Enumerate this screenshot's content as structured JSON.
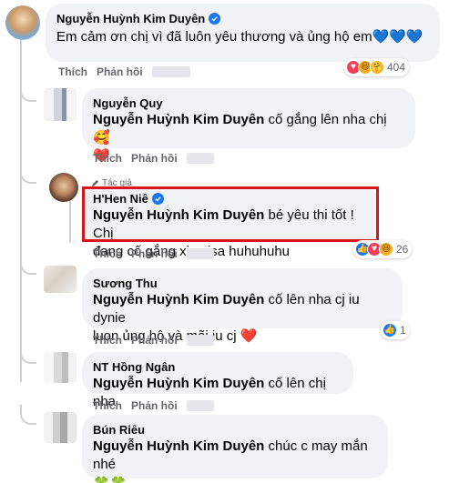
{
  "comments": [
    {
      "author": "Nguyễn Huỳnh Kim Duyên",
      "verified": true,
      "text": "Em cảm ơn chị vì đã luôn yêu thương và ủng hộ em",
      "emoji": "💙💙💙",
      "actions": {
        "like": "Thích",
        "reply": "Phản hồi"
      },
      "reactions": {
        "icons": [
          "heart-icon",
          "haha-icon",
          "care-icon"
        ],
        "count": "404"
      }
    }
  ],
  "replies": [
    {
      "author": "Nguyễn Quy",
      "mention": "Nguyễn Huỳnh Kim Duyên",
      "text": "cố gắng lên nha chị 🥰",
      "text2": "❤️",
      "actions": {
        "like": "Thích",
        "reply": "Phản hồi"
      }
    },
    {
      "badge": "Tác giả",
      "author": "H'Hen Niê",
      "verified": true,
      "mention": "Nguyễn Huỳnh Kim Duyên",
      "text": "bé yêu thi tốt ! Chị",
      "text2": "đang cố gắng xin visa huhuhuhu",
      "actions": {
        "like": "Thích",
        "reply": "Phản hồi"
      },
      "reactions": {
        "icons": [
          "like-icon",
          "heart-icon",
          "haha-icon"
        ],
        "count": "26"
      }
    },
    {
      "author": "Sương Thu",
      "mention": "Nguyễn Huỳnh Kim Duyên",
      "text": "cố lên nha cj iu dynie",
      "text2": "luon ủng hộ và mãi iu cj ❤️",
      "actions": {
        "like": "Thích",
        "reply": "Phản hồi"
      },
      "reactions": {
        "icons": [
          "like-icon"
        ],
        "count": "1"
      }
    },
    {
      "author": "NT Hồng Ngân",
      "mention": "Nguyễn Huỳnh Kim Duyên",
      "text": "cố lên chị nha",
      "actions": {
        "like": "Thích",
        "reply": "Phản hồi"
      }
    },
    {
      "author": "Bún Riêu",
      "mention": "Nguyễn Huỳnh Kim Duyên",
      "text": "chúc c may mắn nhé",
      "text2": "🍀🍀",
      "actions": {
        "like": "Thích",
        "reply": "Phản hồi"
      }
    }
  ],
  "colors": {
    "accent": "#1877f2",
    "highlight": "#d9141d",
    "bubble": "#f0f2f5",
    "meta": "#65676b"
  }
}
